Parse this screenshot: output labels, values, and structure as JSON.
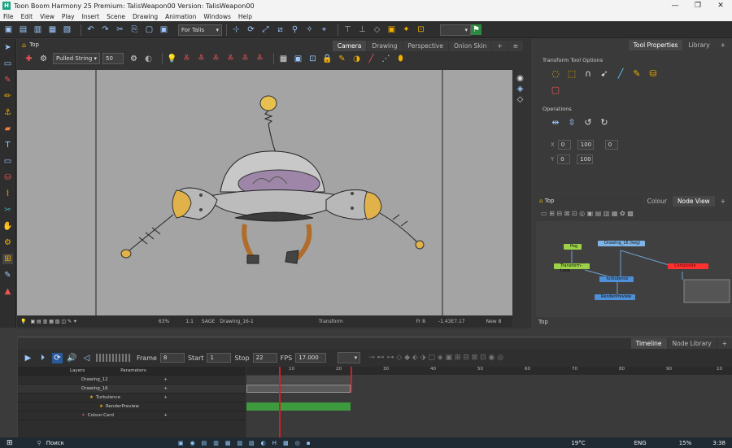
{
  "app": {
    "title": "Toon Boom Harmony 25 Premium: TalisWeapon00 Version: TalisWeapon00",
    "window_controls": [
      "—",
      "❐",
      "✕"
    ]
  },
  "menu": [
    "File",
    "Edit",
    "View",
    "Play",
    "Insert",
    "Scene",
    "Drawing",
    "Animation",
    "Windows",
    "Help"
  ],
  "toolbar": {
    "scene_select": "For Talis"
  },
  "camera": {
    "breadcrumb": "Top",
    "tabs": [
      "Camera",
      "Drawing",
      "Perspective",
      "Onion Skin"
    ],
    "tool_select": "Pulled String",
    "size_value": "50",
    "status": {
      "zoom": "63%",
      "zoom2": "1:1",
      "mode": "SAGE",
      "drawing": "Drawing_16-1",
      "tool": "Transform",
      "frame": "Fr 8",
      "coords": "-1.43E7.17",
      "view": "New 8"
    }
  },
  "tool_properties": {
    "tabs": [
      "Tool Properties",
      "Library"
    ],
    "options_title": "Transform Tool Options",
    "operations_title": "Operations",
    "fields": {
      "x_label": "X",
      "x_value": "0",
      "x2_value": "100",
      "y_label": "Y",
      "y_value": "0",
      "y2_value": "100",
      "angle_value": "0"
    }
  },
  "node_view": {
    "breadcrumb": "Top",
    "tabs": [
      "Colour",
      "Node View"
    ],
    "nodes": [
      {
        "label": "Peg",
        "color": "#9bd248"
      },
      {
        "label": "Drawing_16 (keg)",
        "color": "#7eb3e6"
      },
      {
        "label": "Transform-Loop",
        "color": "#9bd248"
      },
      {
        "label": "Composite",
        "color": "#ff3030"
      },
      {
        "label": "Turbulence",
        "color": "#4f8fd8"
      },
      {
        "label": "RenderPreview",
        "color": "#4f8fd8"
      }
    ],
    "search": "Top"
  },
  "timeline": {
    "tabs": [
      "Timeline",
      "Node Library"
    ],
    "frame_label": "Frame",
    "frame_value": "8",
    "start_label": "Start",
    "start_value": "1",
    "stop_label": "Stop",
    "stop_value": "22",
    "fps_label": "FPS",
    "fps_value": "17.000",
    "layers_header": "Layers",
    "params_header": "Parameters",
    "layers": [
      "Drawing_12",
      "Drawing_16",
      "Turbulence",
      "RenderPreview",
      "Colour-Card"
    ],
    "ruler_marks": [
      "10",
      "20",
      "30",
      "40",
      "50",
      "60",
      "70",
      "80",
      "90",
      "10"
    ]
  },
  "taskbar": {
    "search": "Поиск",
    "weather": "19°C",
    "lang": "ENG",
    "battery": "15%",
    "time": "3:38"
  }
}
